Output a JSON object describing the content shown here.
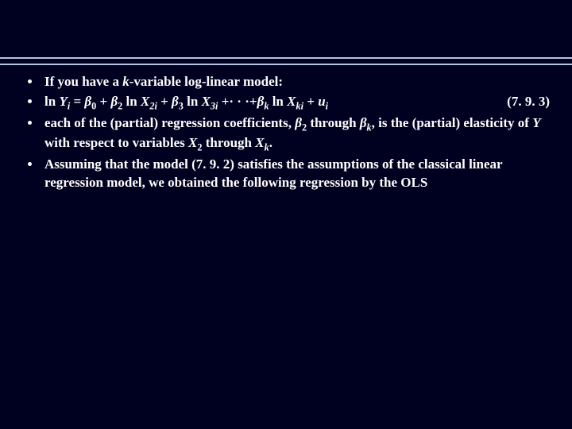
{
  "bullets": {
    "b1": {
      "t1": "If you have a ",
      "k": "k",
      "t2": "-variable log-linear model:"
    },
    "b2": {
      "ln1": "ln ",
      "Y": "Y",
      "i": "i",
      "eq": " = ",
      "beta": "β",
      "s0": "0",
      "plus": " + ",
      "s2": "2",
      "ln2": " ln ",
      "X": "X",
      "s2i": "2i",
      "s3": "3",
      "s3i": "3i",
      "dots": " +· · ·+",
      "sk": "k",
      "ski": "ki",
      "u": "u",
      "num": "(7. 9. 3)"
    },
    "b3": {
      "t1": "each of the (partial) regression coefficients, ",
      "beta": "β",
      "s2": "2",
      "t2": " through ",
      "sk": "k",
      "t3": ", is the (partial) elasticity of ",
      "Y": "Y",
      "t4": " with respect to variables ",
      "X": "X",
      "t5": "."
    },
    "b4": {
      "t": "Assuming that the model (7. 9. 2) satisfies the assumptions of the classical linear regression model, we obtained the following regression by the OLS"
    }
  }
}
